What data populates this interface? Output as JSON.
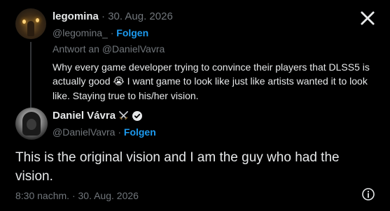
{
  "reply": {
    "author_name": "legomina",
    "separator": "·",
    "date": "30. Aug. 2026",
    "handle": "@legomina_",
    "follow_label": "Folgen",
    "reply_to_prefix": "Antwort an",
    "reply_to_handle": "@DanielVavra",
    "text_before_emoji": "Why every game developer trying to convince their players that DLSS5 is actually good",
    "emoji": "😭",
    "text_after_emoji": "I want game to look like just like artists wanted it to look like. Staying true to his/her vision."
  },
  "main": {
    "author_name": "Daniel Vávra",
    "badge_icon": "crossed-swords-icon",
    "verified_icon": "verified-badge-icon",
    "handle": "@DanielVavra",
    "separator": "·",
    "follow_label": "Folgen",
    "text": "This is the original vision and I am the guy who had the vision.",
    "time": "8:30 nachm.",
    "date": "30. Aug. 2026"
  },
  "colors": {
    "background": "#000000",
    "text": "#e7e9ea",
    "muted": "#71767b",
    "accent": "#1d9bf0"
  },
  "icons": {
    "close": "close-x-icon",
    "info": "info-icon"
  }
}
